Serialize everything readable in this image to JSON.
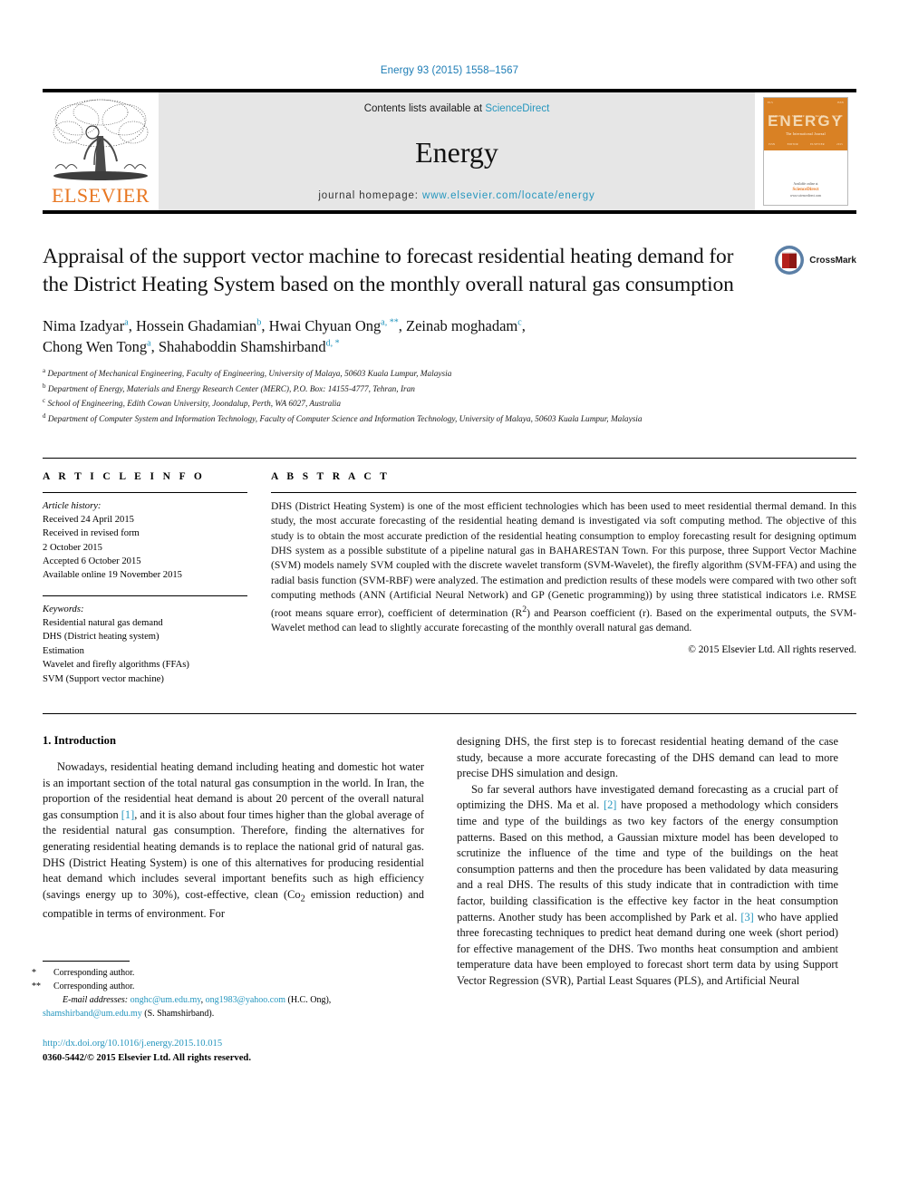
{
  "running_head": "Energy 93 (2015) 1558–1567",
  "masthead": {
    "publisher_name": "ELSEVIER",
    "contents_prefix": "Contents lists available at ",
    "contents_link": "ScienceDirect",
    "journal_title": "Energy",
    "homepage_prefix": "journal homepage: ",
    "homepage_url": "www.elsevier.com/locate/energy",
    "cover": {
      "title": "ENERGY",
      "subtitle": "The International Journal",
      "footer_top": "Available online at",
      "footer_brand": "ScienceDirect",
      "footer_url": "www.sciencedirect.com"
    }
  },
  "article": {
    "title": "Appraisal of the support vector machine to forecast residential heating demand for the District Heating System based on the monthly overall natural gas consumption",
    "crossmark_label": "CrossMark",
    "authors_line_1": "Nima Izadyar",
    "authors": [
      {
        "name": "Nima Izadyar",
        "marks": "a"
      },
      {
        "name": "Hossein Ghadamian",
        "marks": "b"
      },
      {
        "name": "Hwai Chyuan Ong",
        "marks": "a, **"
      },
      {
        "name": "Zeinab moghadam",
        "marks": "c"
      },
      {
        "name": "Chong Wen Tong",
        "marks": "a"
      },
      {
        "name": "Shahaboddin Shamshirband",
        "marks": "d, *"
      }
    ],
    "affiliations": [
      {
        "mark": "a",
        "text": "Department of Mechanical Engineering, Faculty of Engineering, University of Malaya, 50603 Kuala Lumpur, Malaysia"
      },
      {
        "mark": "b",
        "text": "Department of Energy, Materials and Energy Research Center (MERC), P.O. Box: 14155-4777, Tehran, Iran"
      },
      {
        "mark": "c",
        "text": "School of Engineering, Edith Cowan University, Joondalup, Perth, WA 6027, Australia"
      },
      {
        "mark": "d",
        "text": "Department of Computer System and Information Technology, Faculty of Computer Science and Information Technology, University of Malaya, 50603 Kuala Lumpur, Malaysia"
      }
    ]
  },
  "article_info": {
    "heading": "A R T I C L E  I N F O",
    "history_label": "Article history:",
    "history": [
      "Received 24 April 2015",
      "Received in revised form",
      "2 October 2015",
      "Accepted 6 October 2015",
      "Available online 19 November 2015"
    ],
    "keywords_label": "Keywords:",
    "keywords": [
      "Residential natural gas demand",
      "DHS (District heating system)",
      "Estimation",
      "Wavelet and firefly algorithms (FFAs)",
      "SVM (Support vector machine)"
    ]
  },
  "abstract": {
    "heading": "A B S T R A C T",
    "text": "DHS (District Heating System) is one of the most efficient technologies which has been used to meet residential thermal demand. In this study, the most accurate forecasting of the residential heating demand is investigated via soft computing method. The objective of this study is to obtain the most accurate prediction of the residential heating consumption to employ forecasting result for designing optimum DHS system as a possible substitute of a pipeline natural gas in BAHARESTAN Town. For this purpose, three Support Vector Machine (SVM) models namely SVM coupled with the discrete wavelet transform (SVM-Wavelet), the firefly algorithm (SVM-FFA) and using the radial basis function (SVM-RBF) were analyzed. The estimation and prediction results of these models were compared with two other soft computing methods (ANN (Artificial Neural Network) and GP (Genetic programming)) by using three statistical indicators i.e. RMSE (root means square error), coefficient of determination (R2) and Pearson coefficient (r). Based on the experimental outputs, the SVM-Wavelet method can lead to slightly accurate forecasting of the monthly overall natural gas demand.",
    "copyright": "© 2015 Elsevier Ltd. All rights reserved."
  },
  "introduction": {
    "section_number_title": "1. Introduction",
    "left_paragraph_1": "Nowadays, residential heating demand including heating and domestic hot water is an important section of the total natural gas consumption in the world. In Iran, the proportion of the residential heat demand is about 20 percent of the overall natural gas consumption [1], and it is also about four times higher than the global average of the residential natural gas consumption. Therefore, finding the alternatives for generating residential heating demands is to replace the national grid of natural gas. DHS (District Heating System) is one of this alternatives for producing residential heat demand which includes several important benefits such as high efficiency (savings energy up to 30%), cost-effective, clean (Co2 emission reduction) and compatible in terms of environment. For",
    "right_paragraph_1": "designing DHS, the first step is to forecast residential heating demand of the case study, because a more accurate forecasting of the DHS demand can lead to more precise DHS simulation and design.",
    "right_paragraph_2": "So far several authors have investigated demand forecasting as a crucial part of optimizing the DHS. Ma et al. [2] have proposed a methodology which considers time and type of the buildings as two key factors of the energy consumption patterns. Based on this method, a Gaussian mixture model has been developed to scrutinize the influence of the time and type of the buildings on the heat consumption patterns and then the procedure has been validated by data measuring and a real DHS. The results of this study indicate that in contradiction with time factor, building classification is the effective key factor in the heat consumption patterns. Another study has been accomplished by Park et al. [3] who have applied three forecasting techniques to predict heat demand during one week (short period) for effective management of the DHS. Two months heat consumption and ambient temperature data have been employed to forecast short term data by using Support Vector Regression (SVR), Partial Least Squares (PLS), and Artificial Neural"
  },
  "footnotes": {
    "corresponding_1": "Corresponding author.",
    "corresponding_2": "Corresponding author.",
    "email_label": "E-mail addresses:",
    "email_1": "onghc@um.edu.my",
    "email_2": "ong1983@yahoo.com",
    "email_1_owner": "(H.C. Ong),",
    "email_3": "shamshirband@um.edu.my",
    "email_3_owner": "(S. Shamshirband).",
    "doi": "http://dx.doi.org/10.1016/j.energy.2015.10.015",
    "issn_line": "0360-5442/© 2015 Elsevier Ltd. All rights reserved."
  },
  "colors": {
    "link_blue": "#2596be",
    "elsevier_orange": "#E87722",
    "cover_orange": "#d98124",
    "band_gray": "#e6e6e6",
    "crossmark_red": "#b5201c",
    "crossmark_blue": "#5b7fa6"
  }
}
